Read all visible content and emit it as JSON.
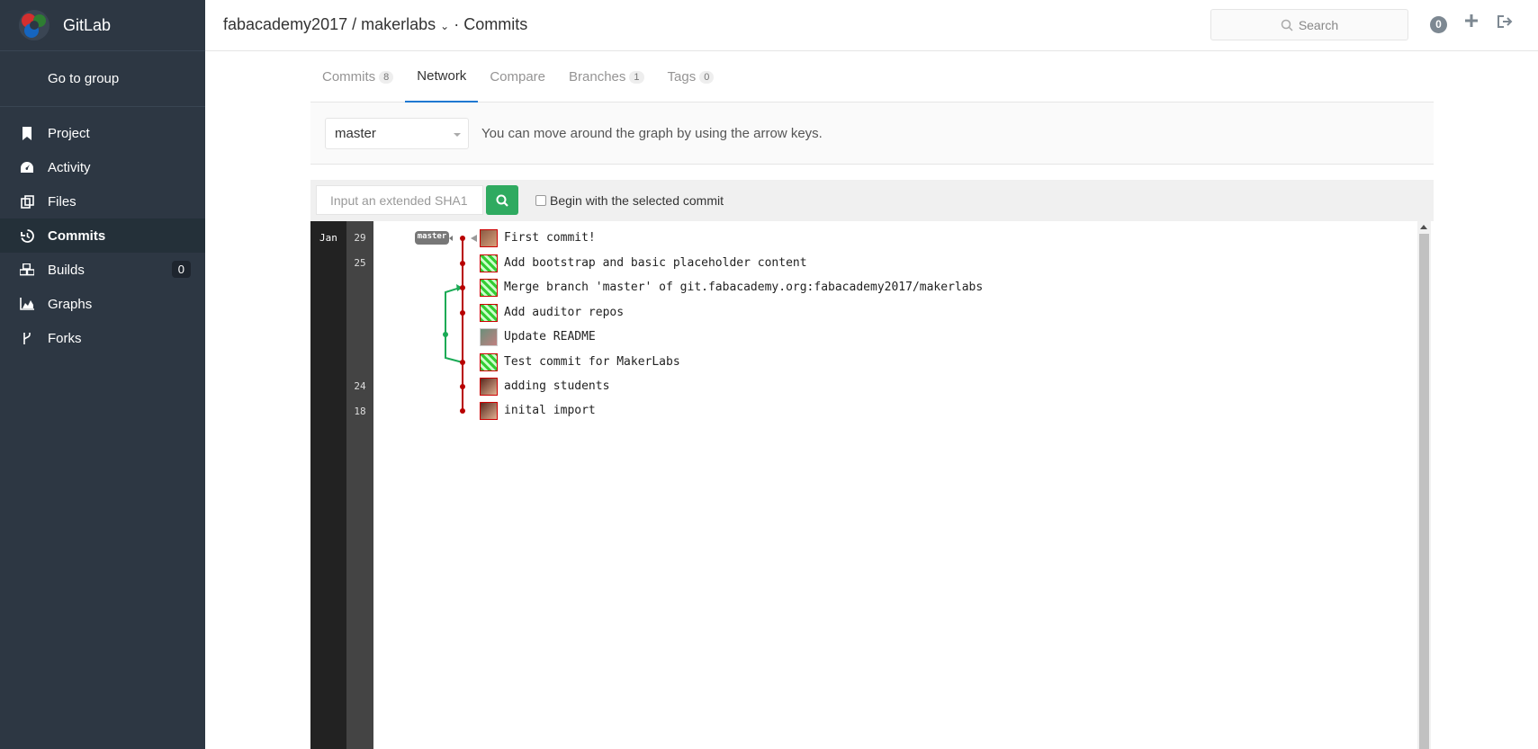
{
  "sidebar": {
    "brand": "GitLab",
    "go_to_group": "Go to group",
    "items": [
      {
        "label": "Project",
        "icon": "bookmark-icon"
      },
      {
        "label": "Activity",
        "icon": "dashboard-icon"
      },
      {
        "label": "Files",
        "icon": "files-icon"
      },
      {
        "label": "Commits",
        "icon": "history-icon",
        "active": true
      },
      {
        "label": "Builds",
        "icon": "cubes-icon",
        "badge": "0"
      },
      {
        "label": "Graphs",
        "icon": "area-chart-icon"
      },
      {
        "label": "Forks",
        "icon": "code-fork-icon"
      }
    ]
  },
  "header": {
    "breadcrumb": "fabacademy2017 / makerlabs",
    "section": "· Commits",
    "search_placeholder": "Search",
    "todo_count": "0"
  },
  "tabs": [
    {
      "label": "Commits",
      "count": "8"
    },
    {
      "label": "Network",
      "active": true
    },
    {
      "label": "Compare"
    },
    {
      "label": "Branches",
      "count": "1"
    },
    {
      "label": "Tags",
      "count": "0"
    }
  ],
  "branch": {
    "selected": "master",
    "help": "You can move around the graph by using the arrow keys."
  },
  "graph_controls": {
    "sha_placeholder": "Input an extended SHA1",
    "begin_label": "Begin with the selected commit"
  },
  "network": {
    "month": "Jan",
    "branch_label": "master",
    "days": [
      "29",
      "25",
      "24",
      "18"
    ],
    "commits": [
      {
        "message": "First commit!",
        "day": "29"
      },
      {
        "message": "Add bootstrap and basic placeholder content",
        "day": "25"
      },
      {
        "message": "Merge branch 'master' of git.fabacademy.org:fabacademy2017/makerlabs",
        "day": ""
      },
      {
        "message": "Add auditor repos",
        "day": ""
      },
      {
        "message": "Update README",
        "day": ""
      },
      {
        "message": "Test commit for MakerLabs",
        "day": ""
      },
      {
        "message": "adding students",
        "day": "24"
      },
      {
        "message": "inital import",
        "day": "18"
      }
    ]
  },
  "colors": {
    "sidebar_bg": "#2d3743",
    "graph_main": "#b80000",
    "graph_branch": "#1aaa55",
    "search_button": "#2faa60"
  }
}
